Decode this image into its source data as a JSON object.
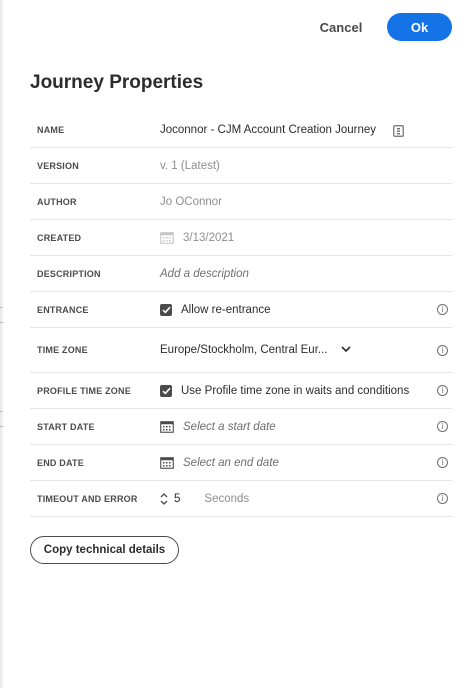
{
  "header": {
    "cancel_label": "Cancel",
    "ok_label": "Ok"
  },
  "title": "Journey Properties",
  "properties": {
    "name": {
      "label": "NAME",
      "value": "Joconnor - CJM Account Creation Journey",
      "icon": "document-icon"
    },
    "version": {
      "label": "VERSION",
      "value": "v. 1 (Latest)"
    },
    "author": {
      "label": "AUTHOR",
      "value": "Jo OConnor"
    },
    "created": {
      "label": "CREATED",
      "value": "3/13/2021",
      "icon": "calendar-icon"
    },
    "description": {
      "label": "DESCRIPTION",
      "placeholder": "Add a description"
    },
    "entrance": {
      "label": "ENTRANCE",
      "checkbox_label": "Allow re-entrance",
      "checked": true
    },
    "time_zone": {
      "label": "TIME ZONE",
      "value": "Europe/Stockholm, Central Eur...",
      "icon": "chevron-down-icon"
    },
    "profile_time_zone": {
      "label": "PROFILE TIME ZONE",
      "checkbox_label": "Use Profile time zone in waits and conditions",
      "checked": true
    },
    "start_date": {
      "label": "START DATE",
      "placeholder": "Select a start date",
      "icon": "calendar-icon"
    },
    "end_date": {
      "label": "END DATE",
      "placeholder": "Select an end date",
      "icon": "calendar-icon"
    },
    "timeout": {
      "label": "TIMEOUT AND ERROR",
      "value": "5",
      "unit": "Seconds",
      "icon": "stepper-icon"
    }
  },
  "info_icon": "i",
  "copy_button_label": "Copy technical details",
  "colors": {
    "accent": "#1473e6",
    "text": "#2c2c2c",
    "muted": "#8e8e8e",
    "divider": "#e6e6e6"
  }
}
